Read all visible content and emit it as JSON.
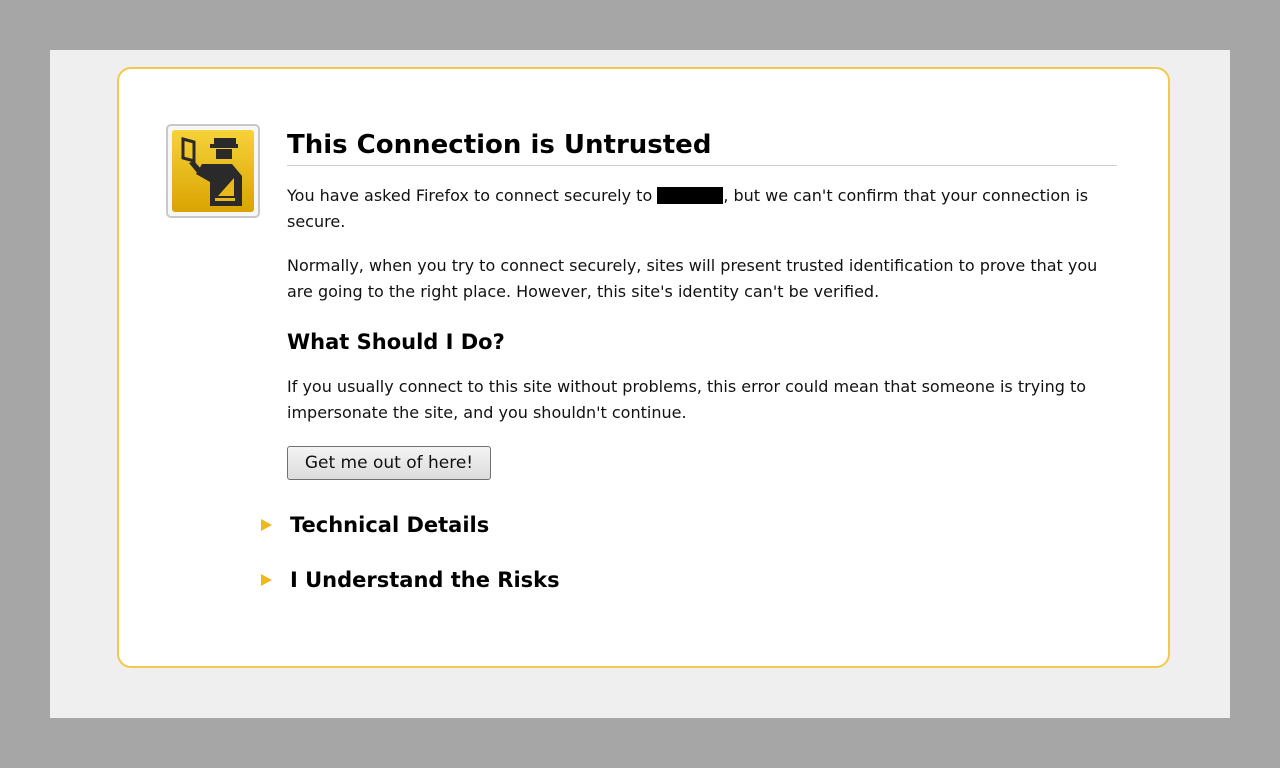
{
  "page": {
    "title": "This Connection is Untrusted",
    "intro_before": "You have asked Firefox to connect securely to ",
    "intro_after": ", but we can't confirm that your connection is secure.",
    "explanation": "Normally, when you try to connect securely, sites will present trusted identification to prove that you are going to the right place. However, this site's identity can't be verified.",
    "section_heading": "What Should I Do?",
    "advice": "If you usually connect to this site without problems, this error could mean that someone is trying to impersonate the site, and you shouldn't continue.",
    "escape_button": "Get me out of here!",
    "technical_details": "Technical Details",
    "understand_risks": "I Understand the Risks"
  },
  "icons": {
    "badge": "security-officer-icon",
    "expander": "triangle-right-icon"
  },
  "colors": {
    "border": "#f4c84a",
    "accent": "#f3b71c",
    "badge_bg": "#e8b81c"
  }
}
